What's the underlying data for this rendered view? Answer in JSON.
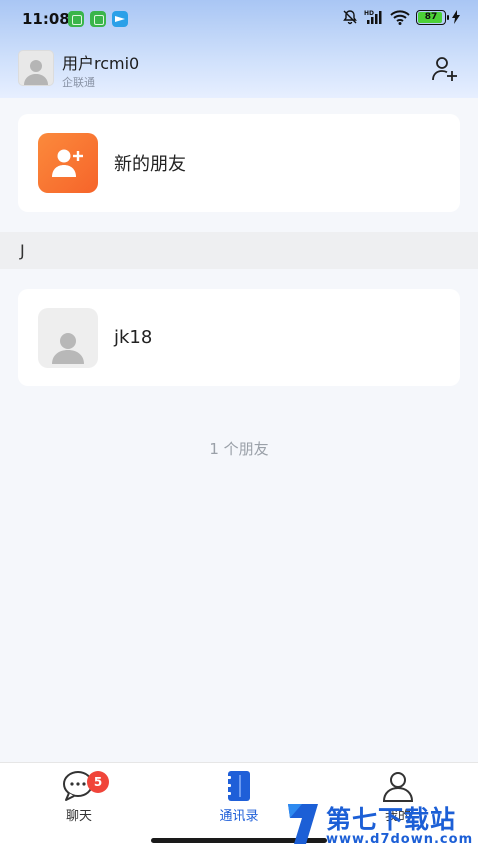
{
  "status_bar": {
    "time": "11:08",
    "battery": "87"
  },
  "header": {
    "user_name": "用户rcmi0",
    "org": "企联通",
    "add_friend_icon": "add-person-icon"
  },
  "new_friends": {
    "label": "新的朋友",
    "icon": "add-person-icon",
    "accent": "#f6642a"
  },
  "section": {
    "letter": "J"
  },
  "contacts": [
    {
      "name": "jk18",
      "avatar": "default-avatar-icon"
    }
  ],
  "friend_count": "1 个朋友",
  "bottom_nav": {
    "items": [
      {
        "label": "聊天",
        "icon": "chat-bubble-icon",
        "badge": "5",
        "active": false
      },
      {
        "label": "通讯录",
        "icon": "address-book-icon",
        "active": true
      },
      {
        "label": "我的",
        "icon": "person-icon",
        "active": false
      }
    ],
    "active_color": "#1f5fd8"
  },
  "watermark": {
    "title": "第七下载站",
    "url": "www.d7down.com"
  }
}
